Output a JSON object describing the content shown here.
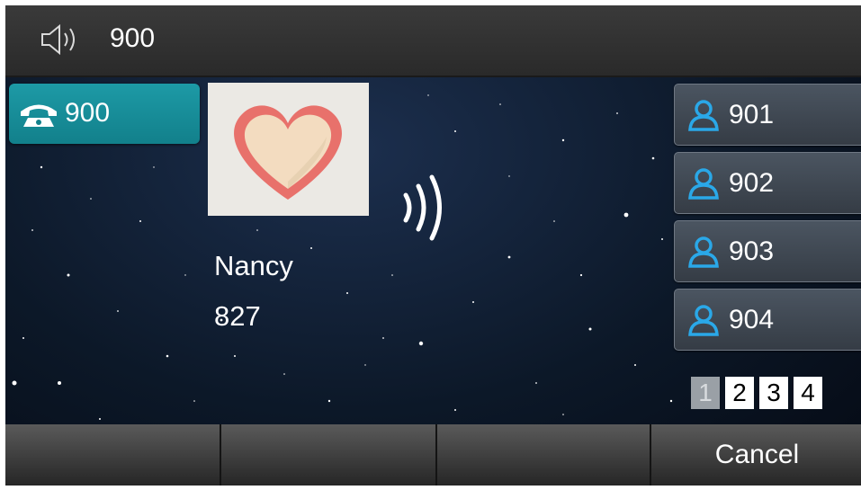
{
  "status_bar": {
    "icon": "speaker-icon",
    "number": "900"
  },
  "account": {
    "icon": "phone-icon",
    "label": "900"
  },
  "call": {
    "photo_icon": "heart-icon",
    "name": "Nancy",
    "number": "827",
    "indicator_icon": "ringing-icon"
  },
  "dss_keys": [
    {
      "icon": "contact-icon",
      "label": "901"
    },
    {
      "icon": "contact-icon",
      "label": "902"
    },
    {
      "icon": "contact-icon",
      "label": "903"
    },
    {
      "icon": "contact-icon",
      "label": "904"
    }
  ],
  "pages": {
    "items": [
      "1",
      "2",
      "3",
      "4"
    ],
    "active": "1"
  },
  "softkeys": [
    "",
    "",
    "",
    "Cancel"
  ],
  "colors": {
    "accent": "#1d9aa6",
    "contact_icon": "#2aa8e8",
    "heart": "#e8716b"
  }
}
